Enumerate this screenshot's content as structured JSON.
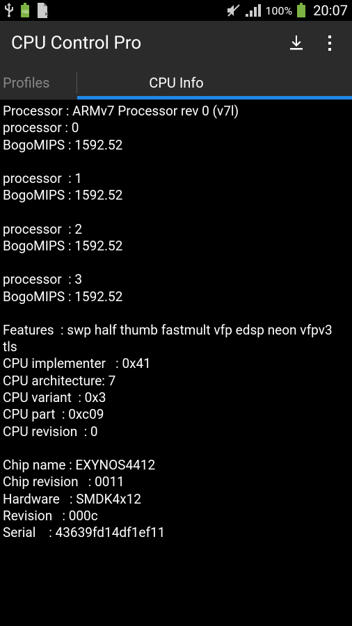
{
  "status": {
    "clock": "20:07",
    "battery_pct": "100%"
  },
  "header": {
    "title": "CPU Control Pro"
  },
  "tabs": {
    "profiles": "Profiles",
    "cpuinfo": "CPU Info",
    "active": "cpuinfo"
  },
  "cpuinfo": {
    "lines": [
      "Processor : ARMv7 Processor rev 0 (v7l)",
      "processor : 0",
      "BogoMIPS : 1592.52",
      "",
      "processor  : 1",
      "BogoMIPS : 1592.52",
      "",
      "processor  : 2",
      "BogoMIPS : 1592.52",
      "",
      "processor  : 3",
      "BogoMIPS : 1592.52",
      "",
      "Features  : swp half thumb fastmult vfp edsp neon vfpv3 tls",
      "CPU implementer   : 0x41",
      "CPU architecture: 7",
      "CPU variant  : 0x3",
      "CPU part  : 0xc09",
      "CPU revision  : 0",
      "",
      "Chip name : EXYNOS4412",
      "Chip revision   : 0011",
      "Hardware   : SMDK4x12",
      "Revision   : 000c",
      "Serial    : 43639fd14df1ef11"
    ]
  }
}
